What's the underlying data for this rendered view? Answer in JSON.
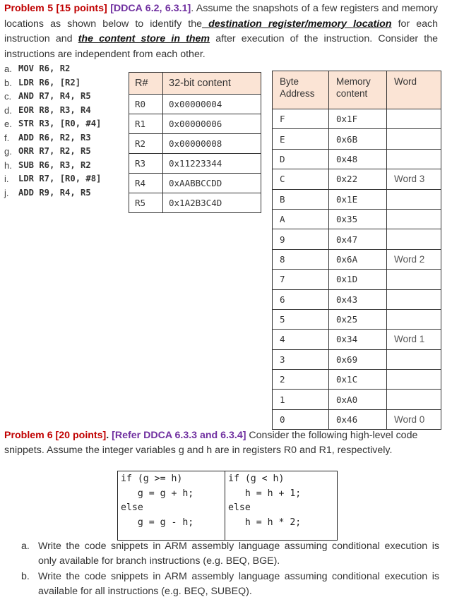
{
  "problem5": {
    "title": "Problem 5 [15 points]",
    "reference": "[DDCA 6.2, 6.3.1]",
    "intro_1": ". Assume the snapshots of a few registers and memory locations as shown below to identify the",
    "emph_1": " destination register/memory location",
    "intro_2": " for each instruction and ",
    "emph_2": "the content store in them",
    "intro_3": " after execution of the instruction. Consider the instructions are independent from each other.",
    "instructions": [
      {
        "letter": "a.",
        "text": "MOV R6, R2"
      },
      {
        "letter": "b.",
        "text": "LDR R6, [R2]"
      },
      {
        "letter": "c.",
        "text": "AND R7, R4, R5"
      },
      {
        "letter": "d.",
        "text": "EOR R8, R3, R4"
      },
      {
        "letter": "e.",
        "text": "STR R3, [R0, #4]"
      },
      {
        "letter": "f.",
        "text": "ADD R6, R2, R3"
      },
      {
        "letter": "g.",
        "text": "ORR R7, R2, R5"
      },
      {
        "letter": "h.",
        "text": "SUB R6, R3, R2"
      },
      {
        "letter": "i.",
        "text": "LDR R7, [R0, #8]"
      },
      {
        "letter": "j.",
        "text": "ADD R9, R4, R5"
      }
    ],
    "register_table": {
      "headers": [
        "R#",
        "32-bit content"
      ],
      "rows": [
        [
          "R0",
          "0x00000004"
        ],
        [
          "R1",
          "0x00000006"
        ],
        [
          "R2",
          "0x00000008"
        ],
        [
          "R3",
          "0x11223344"
        ],
        [
          "R4",
          "0xAABBCCDD"
        ],
        [
          "R5",
          "0x1A2B3C4D"
        ]
      ]
    },
    "memory_table": {
      "headers": [
        "Byte Address",
        "Memory content",
        "Word"
      ],
      "rows": [
        [
          "F",
          "0x1F",
          ""
        ],
        [
          "E",
          "0x6B",
          ""
        ],
        [
          "D",
          "0x48",
          ""
        ],
        [
          "C",
          "0x22",
          "Word 3"
        ],
        [
          "B",
          "0x1E",
          ""
        ],
        [
          "A",
          "0x35",
          ""
        ],
        [
          "9",
          "0x47",
          ""
        ],
        [
          "8",
          "0x6A",
          "Word 2"
        ],
        [
          "7",
          "0x1D",
          ""
        ],
        [
          "6",
          "0x43",
          ""
        ],
        [
          "5",
          "0x25",
          ""
        ],
        [
          "4",
          "0x34",
          "Word 1"
        ],
        [
          "3",
          "0x69",
          ""
        ],
        [
          "2",
          "0x1C",
          ""
        ],
        [
          "1",
          "0xA0",
          ""
        ],
        [
          "0",
          "0x46",
          "Word 0"
        ]
      ]
    }
  },
  "problem6": {
    "title": "Problem 6 [20 points]",
    "dot": ".",
    "reference": "[Refer DDCA 6.3.3 and 6.3.4]",
    "intro": " Consider the following high-level code snippets. Assume the integer variables g and h are in registers R0 and R1, respectively.",
    "snippets": [
      "if (g >= h)\n   g = g + h;\nelse\n   g = g - h;",
      "if (g < h)\n   h = h + 1;\nelse\n   h = h * 2;"
    ],
    "tasks": [
      {
        "letter": "a.",
        "text": "Write the code snippets in ARM assembly language assuming conditional execution is only available for branch instructions (e.g. BEQ, BGE)."
      },
      {
        "letter": "b.",
        "text": "Write the code snippets in ARM assembly language assuming conditional execution is available for all instructions (e.g. BEQ, SUBEQ)."
      }
    ]
  }
}
